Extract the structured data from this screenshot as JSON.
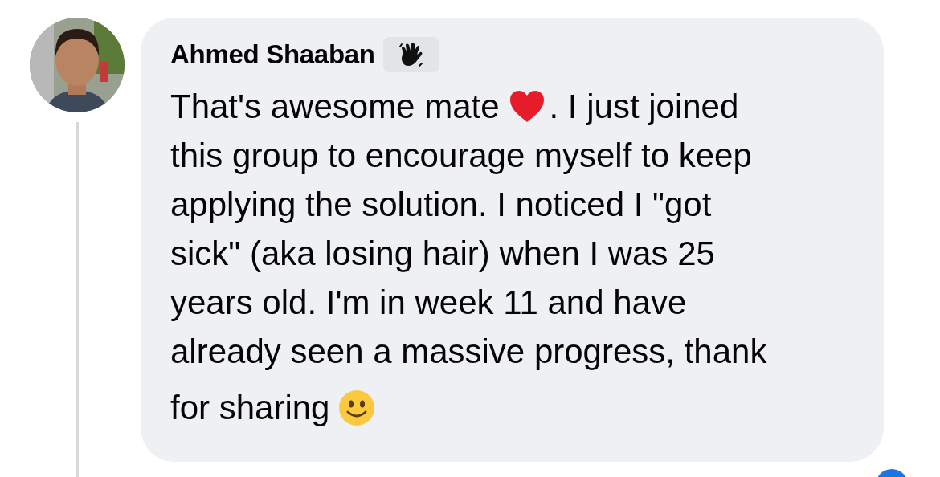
{
  "comment": {
    "author": "Ahmed Shaaban",
    "avatar": {
      "kind": "picture"
    },
    "lines": [
      [
        {
          "kind": "text",
          "text": "That's awesome mate"
        },
        {
          "kind": "heart"
        },
        {
          "kind": "text",
          "text": ". I just joined"
        }
      ],
      [
        {
          "kind": "text",
          "text": "this group to encourage myself to keep"
        }
      ],
      [
        {
          "kind": "text",
          "text": "applying the solution. I noticed I \"got"
        }
      ],
      [
        {
          "kind": "text",
          "text": "sick\" (aka losing hair) when I was 25"
        }
      ],
      [
        {
          "kind": "text",
          "text": "years old. I'm in week 11 and have"
        }
      ],
      [
        {
          "kind": "text",
          "text": "already seen a massive progress, thank"
        }
      ],
      [
        {
          "kind": "text",
          "text": "for sharing"
        },
        {
          "kind": "smile"
        }
      ]
    ]
  }
}
